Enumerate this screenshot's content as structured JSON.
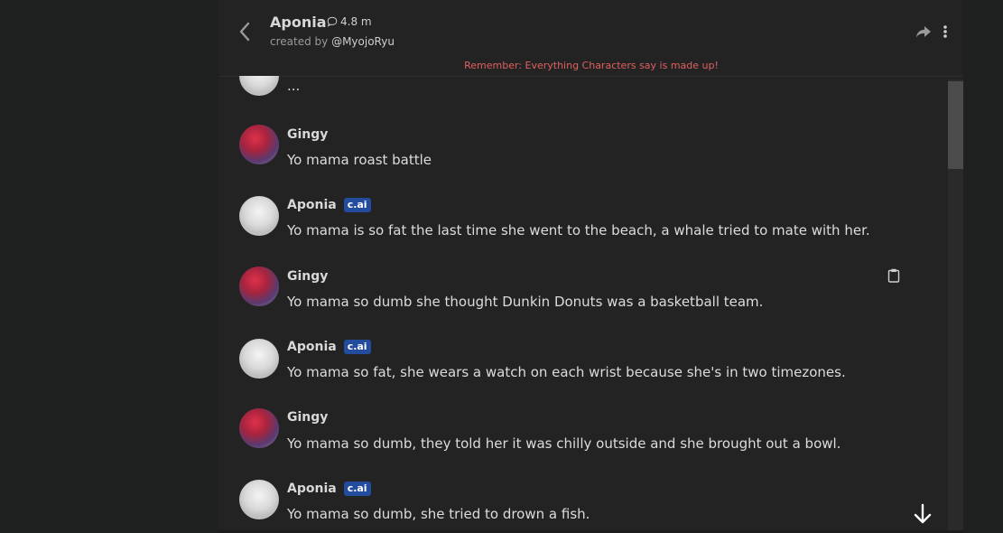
{
  "header": {
    "character_name": "Aponia",
    "chat_count": "4.8 m",
    "created_by_prefix": "created by",
    "creator_handle": "@MyojoRyu",
    "icons": {
      "back": "chevron-left-icon",
      "chat": "chat-bubble-icon",
      "share": "share-icon",
      "more": "more-vertical-icon"
    }
  },
  "disclaimer": "Remember: Everything Characters say is made up!",
  "badge_label": "c.ai",
  "messages": [
    {
      "author": "",
      "text": "...",
      "avatar": "aponia"
    },
    {
      "author": "Gingy",
      "text": "Yo mama roast battle",
      "avatar": "gingy"
    },
    {
      "author": "Aponia",
      "text": "Yo mama is so fat the last time she went to the beach, a whale tried to mate with her.",
      "avatar": "aponia",
      "badge": true
    },
    {
      "author": "Gingy",
      "text": "Yo mama so dumb she thought Dunkin Donuts was a basketball team.",
      "avatar": "gingy"
    },
    {
      "author": "Aponia",
      "text": "Yo mama so fat, she wears a watch on each wrist because she's in two timezones.",
      "avatar": "aponia",
      "badge": true
    },
    {
      "author": "Gingy",
      "text": "Yo mama so dumb, they told her it was chilly outside and she brought out a bowl.",
      "avatar": "gingy"
    },
    {
      "author": "Aponia",
      "text": "Yo mama so dumb, she tried to drown a fish.",
      "avatar": "aponia",
      "badge": true
    }
  ],
  "colors": {
    "background": "#1f2020",
    "panel": "#232323",
    "disclaimer": "#e06060",
    "badge": "#234b9e"
  }
}
